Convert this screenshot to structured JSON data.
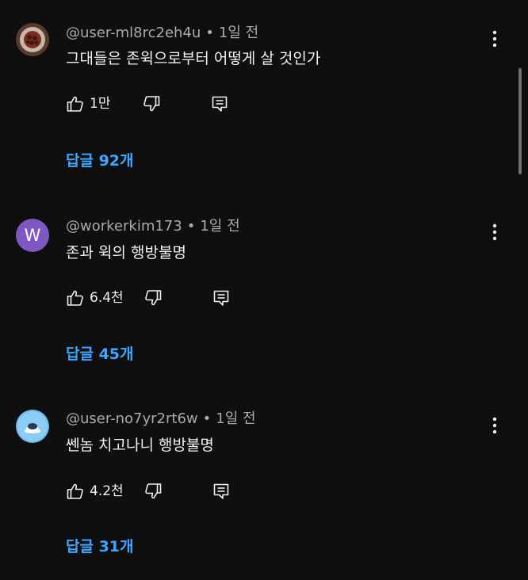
{
  "comments": [
    {
      "username": "@user-ml8rc2eh4u",
      "time": "1일 전",
      "text": "그대들은 존윅으로부터 어떻게 살 것인가",
      "likes": "1만",
      "replies": "답글 92개",
      "avatar_type": "photo"
    },
    {
      "username": "@workerkim173",
      "time": "1일 전",
      "text": "존과 윅의 행방불명",
      "likes": "6.4천",
      "replies": "답글 45개",
      "avatar_type": "letter",
      "avatar_letter": "W",
      "avatar_color": "#7e57c2"
    },
    {
      "username": "@user-no7yr2rt6w",
      "time": "1일 전",
      "text": "쎈놈 치고나니 행방불명",
      "likes": "4.2천",
      "replies": "답글 31개",
      "avatar_type": "photo"
    }
  ],
  "icons": {
    "like": "thumb-up-icon",
    "dislike": "thumb-down-icon",
    "reply": "reply-comment-icon",
    "more": "more-vertical-icon"
  },
  "colors": {
    "background": "#0f0f0f",
    "text": "#f1f1f1",
    "meta": "#aaaaaa",
    "link": "#3ea6ff"
  }
}
